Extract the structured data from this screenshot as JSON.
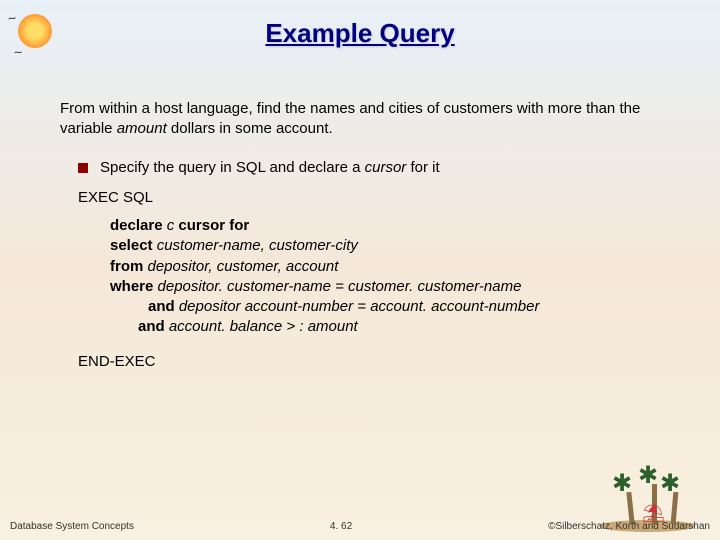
{
  "title": "Example Query",
  "intro_pre": "From within a host language, find the names and cities of customers with more than the variable ",
  "intro_var": "amount",
  "intro_post": " dollars in some account.",
  "bullet_pre": "Specify the query in SQL and declare a ",
  "bullet_em": "cursor",
  "bullet_post": " for it",
  "exec_start": "EXEC SQL",
  "sql": {
    "l1_a": "declare ",
    "l1_b": "c ",
    "l1_c": "cursor for",
    "l2_a": "select ",
    "l2_b": "customer-name, customer-city",
    "l3_a": "from ",
    "l3_b": "depositor, customer, account",
    "l4_a": "where ",
    "l4_b": "depositor. customer-name = customer. customer-name ",
    "l5_a": "and ",
    "l5_b": "depositor account-number = account. account-number ",
    "l6_a": "and ",
    "l6_b": "account. balance > : amount"
  },
  "exec_end": "END-EXEC",
  "footer": {
    "left": "Database System Concepts",
    "center": "4. 62",
    "right": "©Silberschatz, Korth and Sudarshan"
  }
}
